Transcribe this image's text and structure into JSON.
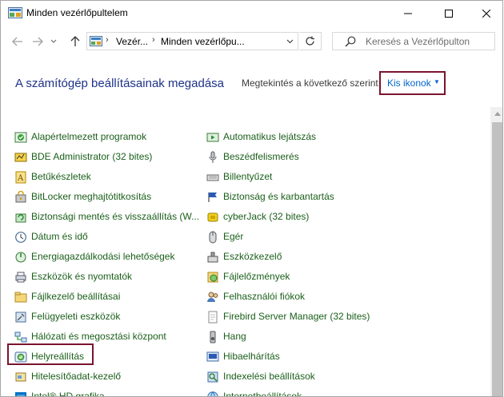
{
  "window": {
    "title": "Minden vezérlőpultelem"
  },
  "nav": {
    "breadcrumb": [
      "Vezér...",
      "Minden vezérlőpu..."
    ],
    "search_placeholder": "Keresés a Vezérlőpulton"
  },
  "header": {
    "title": "A számítógép beállításainak megadása",
    "view_label": "Megtekintés a következő szerint:",
    "view_value": "Kis ikonok"
  },
  "items_left": [
    {
      "label": "Alapértelmezett programok",
      "icon": "default-programs-icon"
    },
    {
      "label": "BDE Administrator (32 bites)",
      "icon": "bde-administrator-icon"
    },
    {
      "label": "Betűkészletek",
      "icon": "fonts-icon"
    },
    {
      "label": "BitLocker meghajtótitkosítás",
      "icon": "bitlocker-icon"
    },
    {
      "label": "Biztonsági mentés és visszaállítás (W...",
      "icon": "backup-restore-icon"
    },
    {
      "label": "Dátum és idő",
      "icon": "date-time-icon"
    },
    {
      "label": "Energiagazdálkodási lehetőségek",
      "icon": "power-options-icon"
    },
    {
      "label": "Eszközök és nyomtatók",
      "icon": "devices-printers-icon"
    },
    {
      "label": "Fájlkezelő beállításai",
      "icon": "file-explorer-options-icon"
    },
    {
      "label": "Felügyeleti eszközök",
      "icon": "administrative-tools-icon"
    },
    {
      "label": "Hálózati és megosztási központ",
      "icon": "network-sharing-icon"
    },
    {
      "label": "Helyreállítás",
      "icon": "recovery-icon"
    },
    {
      "label": "Hitelesítőadat-kezelő",
      "icon": "credential-manager-icon"
    },
    {
      "label": "Intel® HD grafika",
      "icon": "intel-graphics-icon"
    }
  ],
  "items_right": [
    {
      "label": "Automatikus lejátszás",
      "icon": "autoplay-icon"
    },
    {
      "label": "Beszédfelismerés",
      "icon": "speech-recognition-icon"
    },
    {
      "label": "Billentyűzet",
      "icon": "keyboard-icon"
    },
    {
      "label": "Biztonság és karbantartás",
      "icon": "security-maintenance-icon"
    },
    {
      "label": "cyberJack  (32 bites)",
      "icon": "cyberjack-icon"
    },
    {
      "label": "Egér",
      "icon": "mouse-icon"
    },
    {
      "label": "Eszközkezelő",
      "icon": "device-manager-icon"
    },
    {
      "label": "Fájlelőzmények",
      "icon": "file-history-icon"
    },
    {
      "label": "Felhasználói fiókok",
      "icon": "user-accounts-icon"
    },
    {
      "label": "Firebird Server Manager (32 bites)",
      "icon": "firebird-icon"
    },
    {
      "label": "Hang",
      "icon": "sound-icon"
    },
    {
      "label": "Hibaelhárítás",
      "icon": "troubleshooting-icon"
    },
    {
      "label": "Indexelési beállítások",
      "icon": "indexing-options-icon"
    },
    {
      "label": "Internetbeállítások",
      "icon": "internet-options-icon"
    }
  ],
  "colors": {
    "link": "#1a5e1a",
    "heading": "#1e3287",
    "highlight_border": "#7a1430",
    "accent": "#0066cc"
  }
}
